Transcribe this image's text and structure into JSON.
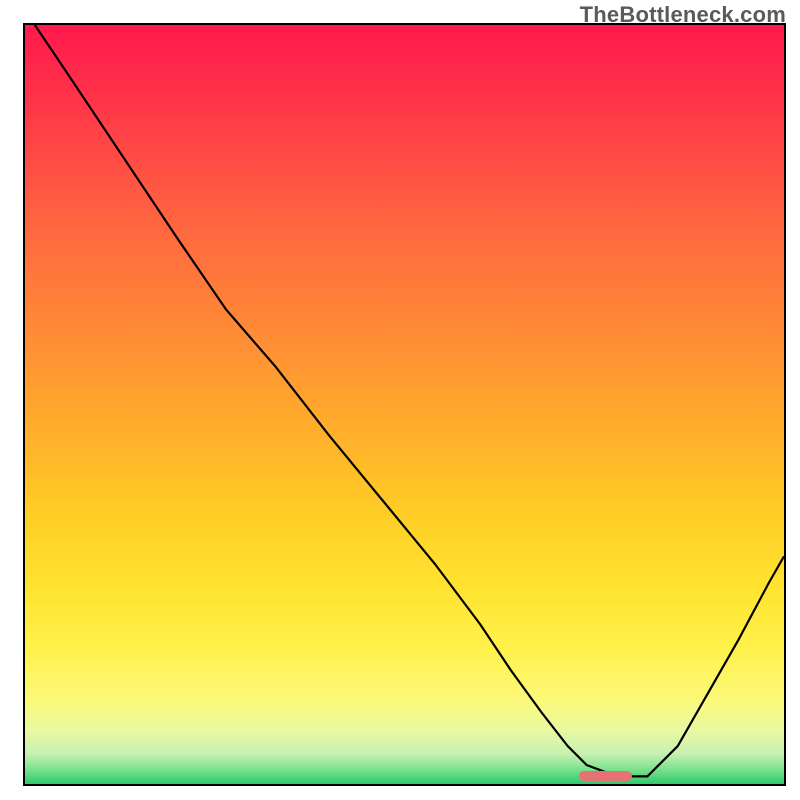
{
  "watermark": "TheBottleneck.com",
  "accent_color": "#e57373",
  "chart_data": {
    "type": "line",
    "title": "",
    "xlabel": "",
    "ylabel": "",
    "xlim": [
      0,
      100
    ],
    "ylim": [
      0,
      100
    ],
    "grid": false,
    "legend": false,
    "background": "red-yellow-green vertical gradient (heat style)",
    "note": "Axes are unlabeled in the image; x and y values are read in percent of the plot area (0 = left/bottom, 100 = right/top) since no numeric ticks are drawn.",
    "series": [
      {
        "name": "bottleneck-curve",
        "color": "#000000",
        "x": [
          1.3,
          6,
          13,
          20,
          26.5,
          33,
          40,
          47,
          54,
          60,
          64,
          68,
          71.5,
          74,
          78,
          82,
          86,
          90,
          94,
          98,
          100
        ],
        "y": [
          100,
          93,
          82.5,
          72,
          62.5,
          55,
          46,
          37.5,
          29,
          21,
          15,
          9.5,
          5,
          2.5,
          1,
          1,
          5,
          12,
          19,
          26.5,
          30
        ]
      }
    ],
    "marker": {
      "name": "optimal-range",
      "x_start": 73,
      "x_end": 80,
      "y": 1,
      "color": "#e57373"
    }
  }
}
